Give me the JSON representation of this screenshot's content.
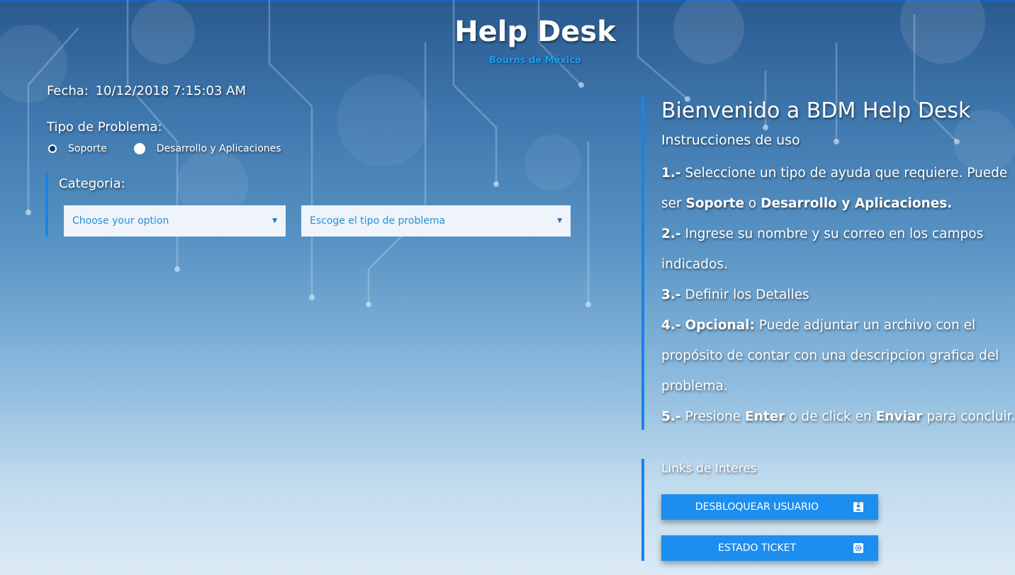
{
  "header": {
    "title": "Help Desk",
    "subtitle": "Bourns de México"
  },
  "form": {
    "fecha_label": "Fecha:",
    "fecha_value": "10/12/2018 7:15:03 AM",
    "tipo_label": "Tipo de Problema:",
    "radio_options": [
      "Soporte",
      "Desarrollo y Aplicaciones"
    ],
    "categoria_label": "Categoria:",
    "select_category_placeholder": "Choose your option",
    "select_problem_placeholder": "Escoge el tipo de problema"
  },
  "welcome": {
    "title": "Bienvenido a BDM Help Desk",
    "instructions_title": "Instrucciones de uso",
    "steps": [
      {
        "num": "1.-",
        "parts": [
          "Seleccione un tipo de ayuda que requiere. Puede ser ",
          "Soporte",
          " o ",
          "Desarrollo y Aplicaciones."
        ]
      },
      {
        "num": "2.-",
        "text": "Ingrese su nombre y su correo en los campos indicados."
      },
      {
        "num": "3.-",
        "text": "Definir los Detalles"
      },
      {
        "num": "4.-",
        "bold": "Opcional:",
        "text": "Puede adjuntar un archivo con el propósito de contar con una descripcion grafica del problema."
      },
      {
        "num": "5.-",
        "parts": [
          "Presione ",
          "Enter",
          " o de click en ",
          "Enviar",
          " para concluir."
        ]
      }
    ]
  },
  "links": {
    "title": "Links de Interes",
    "buttons": [
      {
        "label": "DESBLOQUEAR USUARIO",
        "icon": "user-badge-icon"
      },
      {
        "label": "ESTADO TICKET",
        "icon": "gear-icon"
      }
    ]
  },
  "colors": {
    "accent": "#1c8ef0",
    "border_accent": "#1684e8",
    "subtitle": "#1e9bef",
    "select_text": "#2a8fd6"
  }
}
